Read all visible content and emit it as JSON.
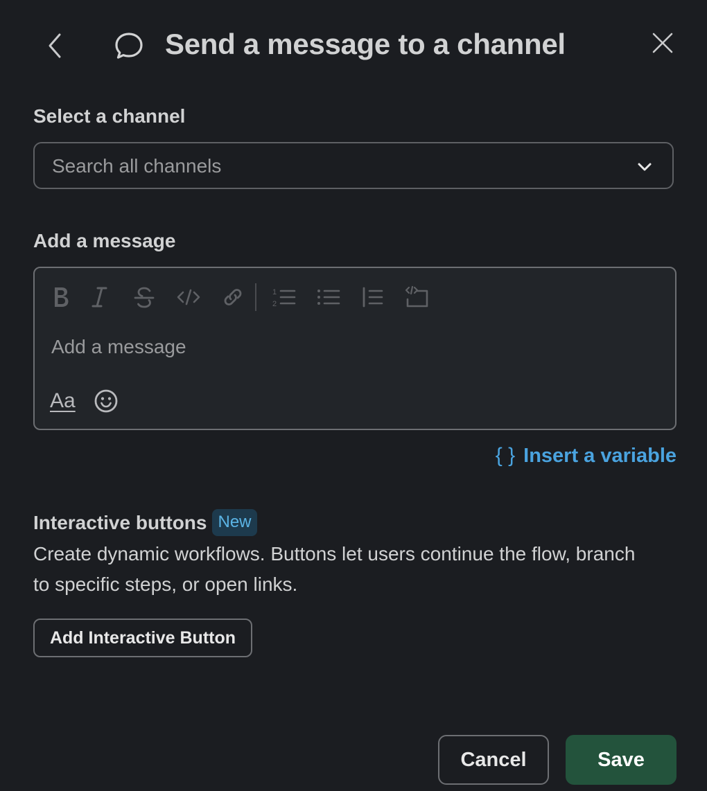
{
  "header": {
    "title": "Send a message to a channel",
    "back_icon": "chevron-left-icon",
    "title_icon": "message-bubble-icon",
    "close_icon": "close-icon"
  },
  "channel": {
    "label": "Select a channel",
    "placeholder": "Search all channels",
    "dropdown_icon": "chevron-down-icon"
  },
  "message": {
    "label": "Add a message",
    "placeholder": "Add a message",
    "toolbar_icons": [
      "bold-icon",
      "italic-icon",
      "strikethrough-icon",
      "code-icon",
      "link-icon",
      "ordered-list-icon",
      "bulleted-list-icon",
      "blockquote-icon",
      "code-block-icon"
    ],
    "format_label": "Aa",
    "emoji_icon": "emoji-icon"
  },
  "insert_variable": {
    "braces": "{ }",
    "label": "Insert a variable"
  },
  "interactive_buttons": {
    "title": "Interactive buttons",
    "badge": "New",
    "description": "Create dynamic workflows. Buttons let users continue the flow, branch to specific steps, or open links.",
    "add_button_label": "Add Interactive Button"
  },
  "footer": {
    "cancel_label": "Cancel",
    "save_label": "Save"
  },
  "colors": {
    "background": "#1b1d21",
    "link": "#4aa3df",
    "save": "#23533c",
    "badge_bg": "#1d3a4d"
  }
}
